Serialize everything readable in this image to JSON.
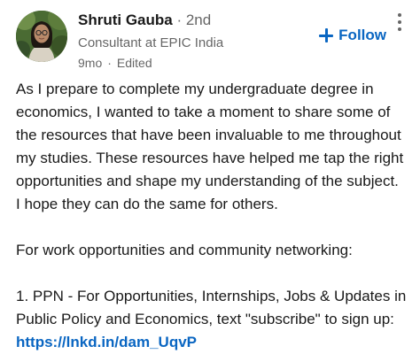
{
  "author": {
    "name": "Shruti Gauba",
    "connection_degree": "· 2nd",
    "headline": "Consultant at EPIC India",
    "time_ago": "9mo",
    "separator": "·",
    "edited_label": "Edited"
  },
  "actions": {
    "follow_label": "Follow",
    "follow_icon": "plus-icon",
    "more_icon": "more-vertical-icon"
  },
  "post": {
    "lines_paragraph1": [
      "As I prepare to complete my undergraduate degree in",
      "economics, I wanted to take a moment to share some of",
      "the resources that have been invaluable to me throughout",
      "my studies. These resources have helped me tap the right",
      "opportunities and shape my understanding of the subject.",
      "I hope they can do the same for others."
    ],
    "paragraph2": "For work opportunities and community networking:",
    "lines_item1": [
      "1. PPN -  For Opportunities, Internships, Jobs & Updates in",
      "Public Policy and Economics, text \"subscribe\" to sign up:"
    ],
    "link": "https://lnkd.in/dam_UqvP"
  },
  "colors": {
    "link": "#0a66c2",
    "text": "#191919",
    "muted": "#666666"
  }
}
